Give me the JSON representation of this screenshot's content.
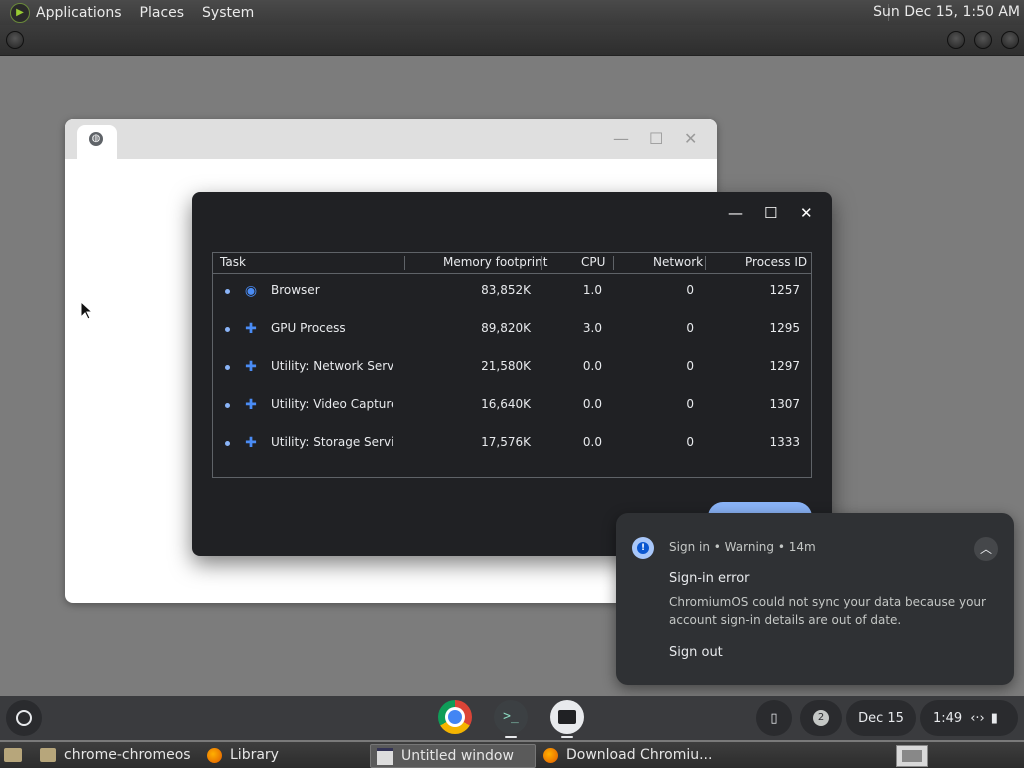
{
  "top_panel": {
    "menus": [
      "Applications",
      "Places",
      "System"
    ],
    "clock": "Sun Dec 15,  1:50 AM"
  },
  "task_manager": {
    "columns": [
      "Task",
      "Memory footprint",
      "CPU",
      "Network",
      "Process ID"
    ],
    "rows": [
      {
        "name": "Browser",
        "memory": "83,852K",
        "cpu": "1.0",
        "network": "0",
        "pid": "1257",
        "icon": "chrome-icon"
      },
      {
        "name": "GPU Process",
        "memory": "89,820K",
        "cpu": "3.0",
        "network": "0",
        "pid": "1295",
        "icon": "puzzle-icon"
      },
      {
        "name": "Utility: Network Service",
        "memory": "21,580K",
        "cpu": "0.0",
        "network": "0",
        "pid": "1297",
        "icon": "puzzle-icon"
      },
      {
        "name": "Utility: Video Capture",
        "memory": "16,640K",
        "cpu": "0.0",
        "network": "0",
        "pid": "1307",
        "icon": "puzzle-icon"
      },
      {
        "name": "Utility: Storage Service",
        "memory": "17,576K",
        "cpu": "0.0",
        "network": "0",
        "pid": "1333",
        "icon": "puzzle-icon"
      }
    ]
  },
  "notification": {
    "source": "Sign in",
    "severity": "Warning",
    "age": "14m",
    "title": "Sign-in error",
    "body": "ChromiumOS could not sync your data because your account sign-in details are out of date.",
    "action": "Sign out"
  },
  "shelf": {
    "notification_count": "2",
    "date": "Dec 15",
    "time": "1:49"
  },
  "taskbar": {
    "items": [
      "chrome-chromeos",
      "Library",
      "Untitled window",
      "Download Chromiu..."
    ]
  }
}
